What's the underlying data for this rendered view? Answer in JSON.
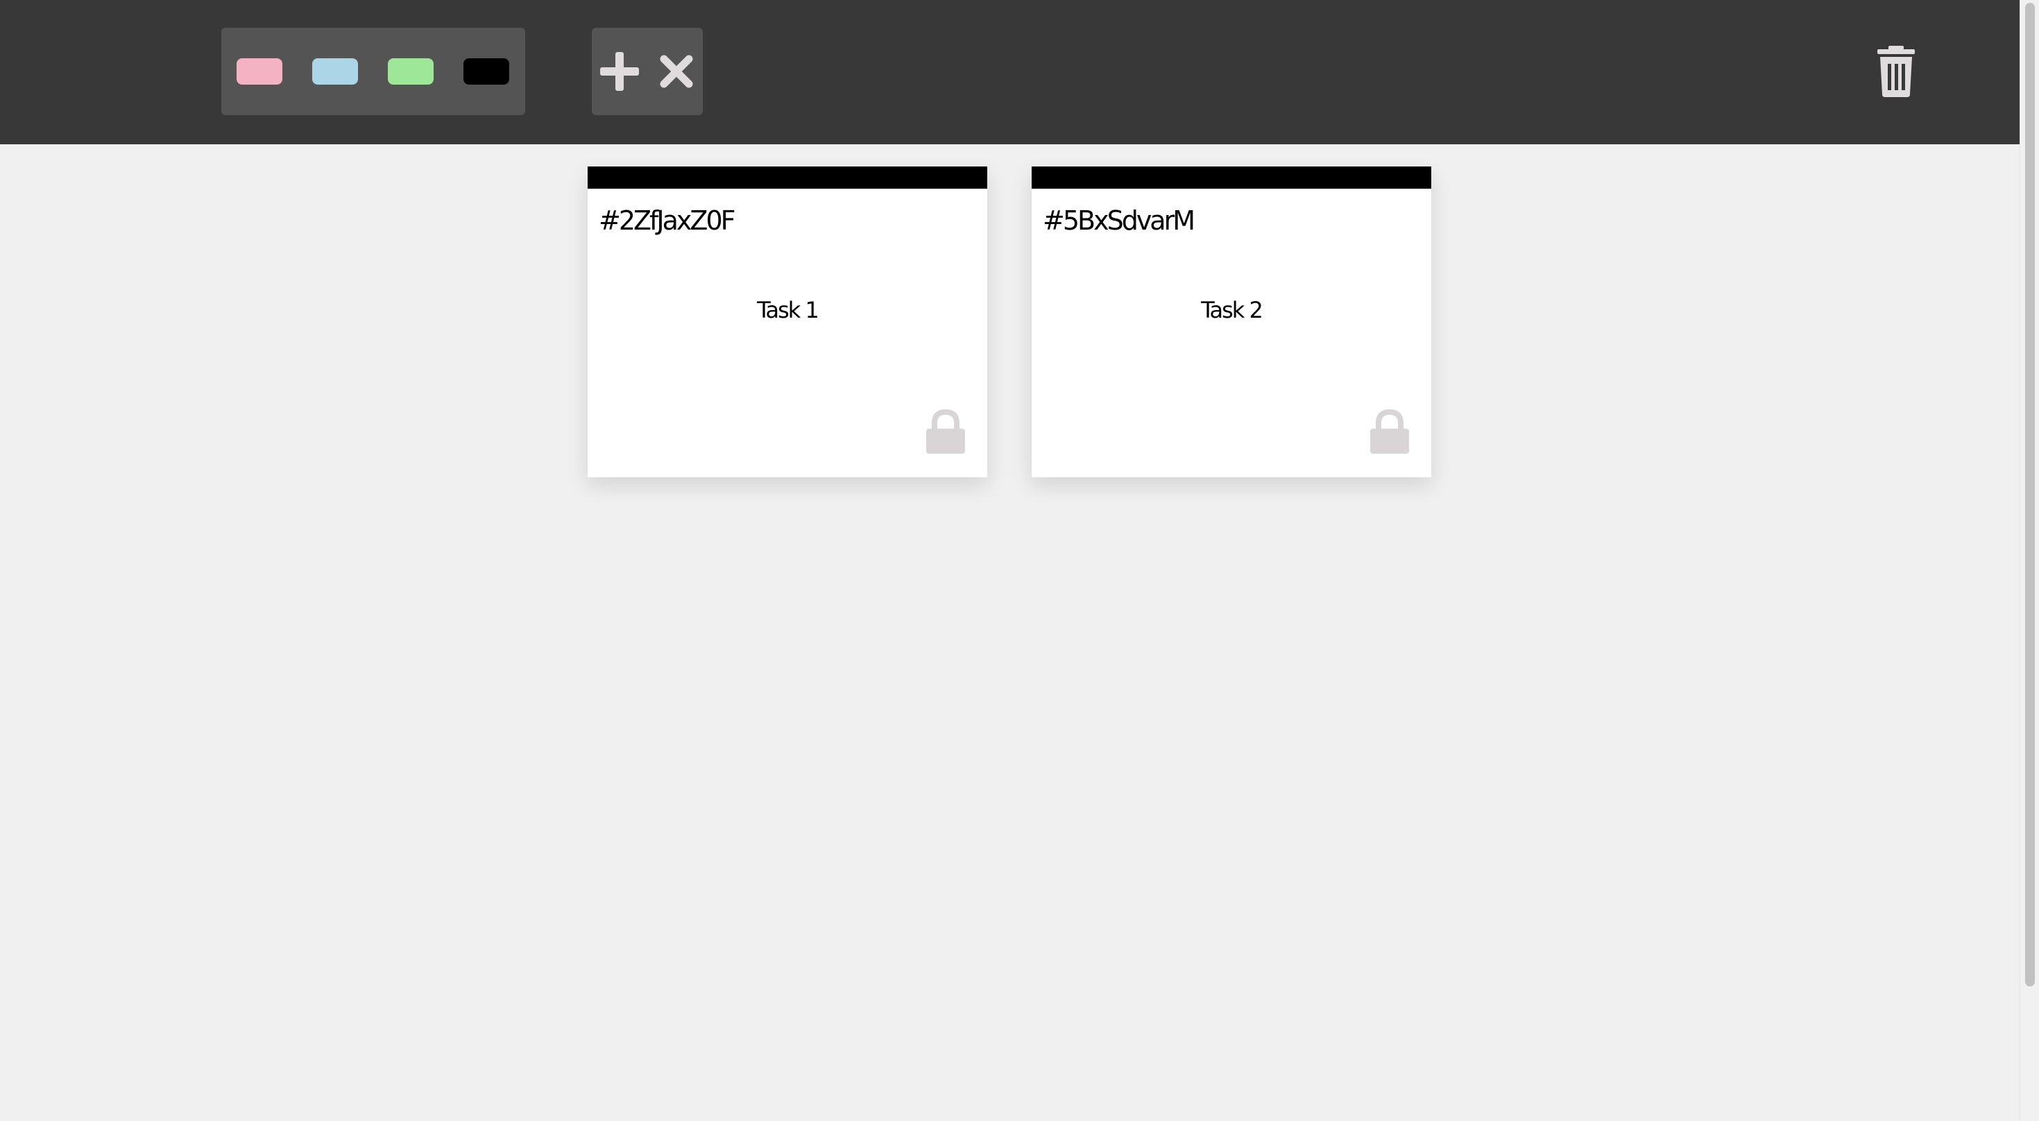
{
  "toolbar": {
    "colors": [
      {
        "name": "pink",
        "hex": "#f4b3c2"
      },
      {
        "name": "light-blue",
        "hex": "#acd5e7"
      },
      {
        "name": "light-green",
        "hex": "#9ee698"
      },
      {
        "name": "black",
        "hex": "#000000"
      }
    ],
    "actions": {
      "add_icon": "plus-icon",
      "close_icon": "close-icon",
      "trash_icon": "trash-icon"
    }
  },
  "notes": [
    {
      "id": "#2ZfJaxZ0F",
      "text": "Task 1",
      "bar_color": "#000000",
      "lock_icon": "lock-icon"
    },
    {
      "id": "#5BxSdvarM",
      "text": "Task 2",
      "bar_color": "#000000",
      "lock_icon": "lock-icon"
    }
  ],
  "theme": {
    "toolbar_bg": "#383838",
    "group_bg": "#555455",
    "board_bg": "#f0f0f0",
    "icon_color": "#e0dcdd",
    "lock_color": "#d9d4d6"
  }
}
